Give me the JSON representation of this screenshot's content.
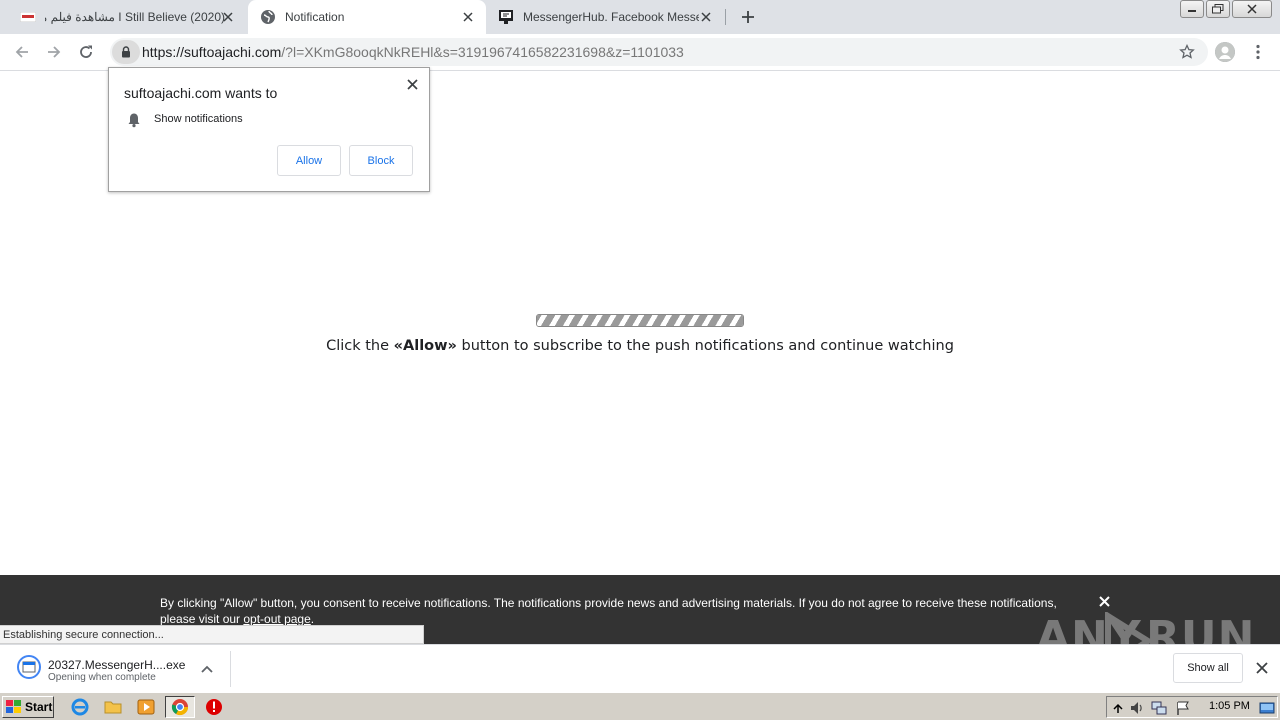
{
  "browser": {
    "tabs": [
      {
        "title": "I Still Believe (2020) مشاهدة فيلم مـ",
        "active": false
      },
      {
        "title": "Notification",
        "active": true
      },
      {
        "title": "MessengerHub. Facebook Messenger",
        "active": false
      }
    ],
    "address": {
      "host": "https://suftoajachi.com",
      "path": "/?l=XKmG8ooqkNkREHl&s=3191967416582231698&z=1101033"
    }
  },
  "permission_popup": {
    "title": "suftoajachi.com wants to",
    "item": "Show notifications",
    "allow_label": "Allow",
    "block_label": "Block"
  },
  "page": {
    "progress_fraction": 1.0,
    "message_before": "Click the ",
    "message_bold": "«Allow»",
    "message_after": " button to subscribe to the push notifications and continue watching"
  },
  "consent": {
    "text": "By clicking \"Allow\" button, you consent to receive notifications. The notifications provide news and advertising materials. If you do not agree to receive these notifications, please visit our ",
    "link_label": "opt-out page",
    "text_end": "."
  },
  "status_bar": {
    "text": "Establishing secure connection..."
  },
  "download": {
    "filename": "20327.MessengerH....exe",
    "status": "Opening when complete",
    "show_all_label": "Show all"
  },
  "taskbar": {
    "start_label": "Start",
    "clock": "1:05 PM"
  },
  "watermark": {
    "text_left": "ANY",
    "text_right": "RUN"
  }
}
